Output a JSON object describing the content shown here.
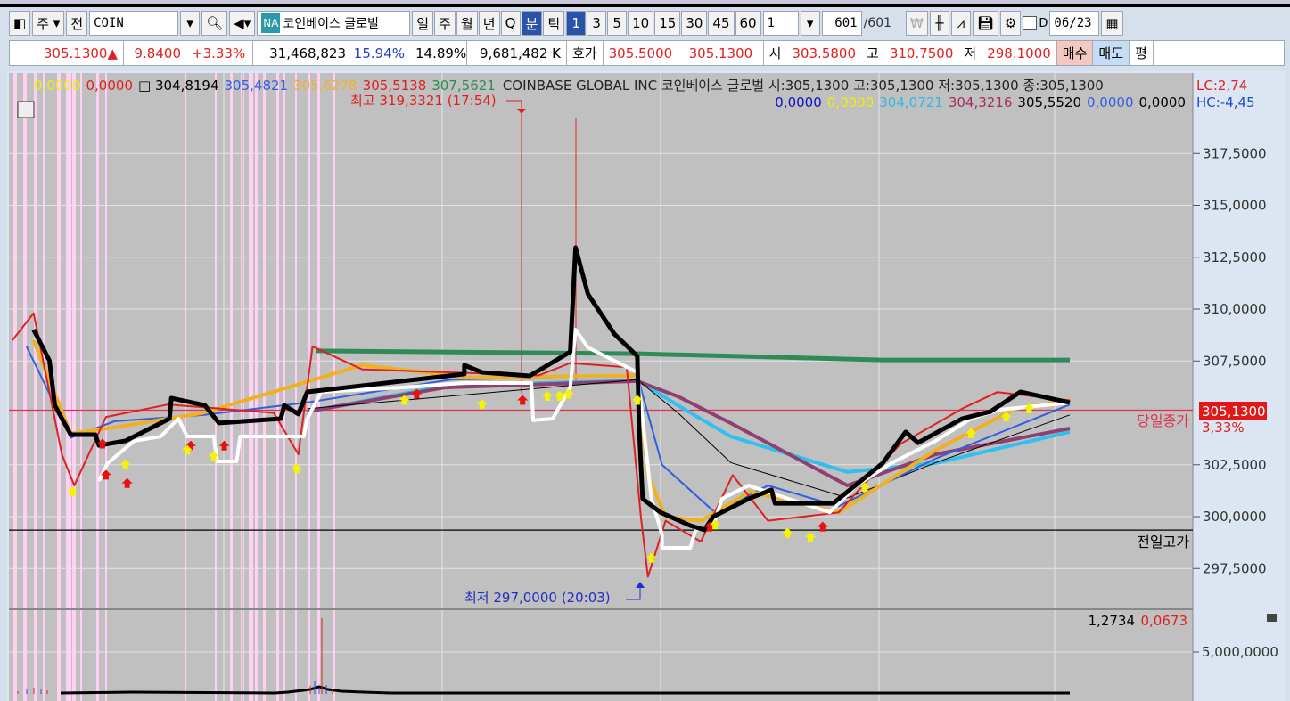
{
  "toolbar": {
    "market": "주",
    "full": "전",
    "symbol": "COIN",
    "name_badge": "NA",
    "name": "코인베이스 글로벌",
    "periods": [
      "일",
      "주",
      "월",
      "년",
      "Q",
      "분",
      "틱"
    ],
    "selected_period": "분",
    "intervals": [
      "1",
      "3",
      "5",
      "10",
      "15",
      "30",
      "45",
      "60"
    ],
    "selected_interval": "1",
    "interval_input": "1",
    "count": "601",
    "count_total": "/601",
    "d_label": "D",
    "date": "06/23"
  },
  "quote": {
    "price": "305.1300▲",
    "change": "9.8400",
    "change_pct": "+3.33%",
    "volume": "31,468,823",
    "pct1": "15.94%",
    "pct2": "14.89%",
    "amount": "9,681,482 K",
    "hoga_label": "호가",
    "hoga1": "305.5000",
    "hoga2": "305.1300",
    "open_label": "시",
    "open": "303.5800",
    "high_label": "고",
    "high": "310.7500",
    "low_label": "저",
    "low": "298.1000",
    "buy": "매수",
    "sell": "매도",
    "avg": "평"
  },
  "legend": {
    "row1": [
      {
        "t": "0,0000",
        "c": "#f0f000"
      },
      {
        "t": "0,0000",
        "c": "#e02020"
      },
      {
        "t": "□ 304,8194",
        "c": "#000000"
      },
      {
        "t": "305,4821",
        "c": "#3060e0"
      },
      {
        "t": "305,6278",
        "c": "#f0b030"
      },
      {
        "t": "305,5138",
        "c": "#e02020"
      },
      {
        "t": "307,5621",
        "c": "#2e8b57"
      }
    ],
    "title": "COINBASE GLOBAL INC  코인베이스 글로벌 시:305,1300 고:305,1300 저:305,1300 종:305,1300",
    "row2": [
      {
        "t": "0,0000",
        "c": "#1010c0"
      },
      {
        "t": "0,0000",
        "c": "#f0f000"
      },
      {
        "t": "304,0721",
        "c": "#30b8e8"
      },
      {
        "t": "304,3216",
        "c": "#a03060"
      },
      {
        "t": "305,5520",
        "c": "#000000"
      },
      {
        "t": "0,0000",
        "c": "#3060e0"
      },
      {
        "t": "0,0000",
        "c": "#000000"
      }
    ],
    "lc": "LC:2,74",
    "hc": "HC:-4,45"
  },
  "annotations": {
    "high": "최고 319,3321 (17:54)",
    "low": "최저 297,0000 (20:03)",
    "today_close": "당일종가",
    "prev_high": "전일고가",
    "current_price": "305,1300",
    "current_pct": "3,33%",
    "vol_vals": [
      "1,2734",
      "0,0673"
    ]
  },
  "chart_data": {
    "type": "line",
    "yticks": [
      "317,5000",
      "315,0000",
      "312,5000",
      "310,0000",
      "307,5000",
      "302,5000",
      "300,0000",
      "297,5000"
    ],
    "ytick_values": [
      317.5,
      315,
      312.5,
      310,
      307.5,
      302.5,
      300,
      297.5
    ],
    "ylim": [
      296.2,
      320.5
    ],
    "xlim": [
      0,
      601
    ],
    "reference_lines": [
      {
        "label": "당일종가",
        "value": 305.13,
        "color": "#e03050"
      },
      {
        "label": "전일고가",
        "value": 299.35,
        "color": "#000000"
      }
    ],
    "volume_ticks": [
      "5,000,0000"
    ],
    "series": [
      {
        "color": "#2e8b57",
        "width": 5,
        "points": [
          [
            174,
            307.99
          ],
          [
            356,
            307.85
          ],
          [
            495,
            307.55
          ],
          [
            601,
            307.55
          ]
        ]
      },
      {
        "color": "#30c0f0",
        "width": 4,
        "points": [
          [
            169,
            305.06
          ],
          [
            247,
            306.3
          ],
          [
            356,
            306.57
          ],
          [
            379,
            305.36
          ],
          [
            409,
            303.86
          ],
          [
            475,
            302.15
          ],
          [
            525,
            302.58
          ],
          [
            601,
            304.08
          ]
        ]
      },
      {
        "color": "#904070",
        "width": 4,
        "points": [
          [
            169,
            305.06
          ],
          [
            247,
            306.22
          ],
          [
            356,
            306.53
          ],
          [
            379,
            305.79
          ],
          [
            409,
            304.5
          ],
          [
            475,
            301.5
          ],
          [
            525,
            303
          ],
          [
            601,
            304.25
          ]
        ]
      },
      {
        "color": "#000000",
        "width": 1,
        "points": [
          [
            169,
            305.2
          ],
          [
            356,
            306.6
          ],
          [
            379,
            305.0
          ],
          [
            409,
            302.6
          ],
          [
            475,
            300.9
          ],
          [
            525,
            302.6
          ],
          [
            601,
            304.9
          ]
        ]
      },
      {
        "color": "#3060e0",
        "width": 2,
        "points": [
          [
            10,
            308.2
          ],
          [
            35,
            303.8
          ],
          [
            60,
            304.6
          ],
          [
            110,
            304.9
          ],
          [
            169,
            305.5
          ],
          [
            250,
            306.6
          ],
          [
            356,
            306.8
          ],
          [
            370,
            302.5
          ],
          [
            400,
            300.2
          ],
          [
            430,
            301.5
          ],
          [
            470,
            300.5
          ],
          [
            525,
            302.8
          ],
          [
            601,
            305.4
          ]
        ]
      },
      {
        "color": "#f0b020",
        "width": 4,
        "points": [
          [
            14,
            308.5
          ],
          [
            35,
            304.0
          ],
          [
            60,
            304.3
          ],
          [
            110,
            305.0
          ],
          [
            169,
            306.5
          ],
          [
            200,
            307.3
          ],
          [
            260,
            306.7
          ],
          [
            356,
            306.8
          ],
          [
            362,
            302
          ],
          [
            372,
            300
          ],
          [
            392,
            299.8
          ],
          [
            420,
            301.2
          ],
          [
            470,
            300.2
          ],
          [
            525,
            303.2
          ],
          [
            570,
            305.2
          ],
          [
            601,
            305.6
          ]
        ]
      },
      {
        "color": "#e02020",
        "width": 2,
        "points": [
          [
            2,
            308.5
          ],
          [
            14,
            309.8
          ],
          [
            30,
            303.0
          ],
          [
            37,
            301.5
          ],
          [
            55,
            304.8
          ],
          [
            90,
            305.4
          ],
          [
            150,
            305.0
          ],
          [
            164,
            303.0
          ],
          [
            172,
            308.2
          ],
          [
            200,
            307.1
          ],
          [
            300,
            306.8
          ],
          [
            318,
            307.4
          ],
          [
            350,
            307.2
          ],
          [
            358,
            300
          ],
          [
            362,
            297.1
          ],
          [
            372,
            299.8
          ],
          [
            392,
            298.8
          ],
          [
            410,
            302
          ],
          [
            430,
            299.8
          ],
          [
            470,
            300.2
          ],
          [
            505,
            303.5
          ],
          [
            540,
            305.2
          ],
          [
            560,
            306.0
          ],
          [
            601,
            305.6
          ]
        ]
      },
      {
        "color": "#ffffff",
        "width": 4,
        "points": [
          [
            51,
            301.72
          ],
          [
            56,
            302.58
          ],
          [
            71,
            303.65
          ],
          [
            86,
            303.86
          ],
          [
            96,
            304.72
          ],
          [
            101,
            303.86
          ],
          [
            116,
            303.86
          ],
          [
            118,
            302.66
          ],
          [
            129,
            302.66
          ],
          [
            131,
            303.86
          ],
          [
            167,
            303.86
          ],
          [
            169,
            304.72
          ],
          [
            177,
            306.01
          ],
          [
            222,
            306.22
          ],
          [
            258,
            306.44
          ],
          [
            296,
            306.44
          ],
          [
            297,
            304.64
          ],
          [
            308,
            304.72
          ],
          [
            318,
            306.22
          ],
          [
            321,
            309.01
          ],
          [
            328,
            308.15
          ],
          [
            356,
            306.95
          ],
          [
            364,
            300.86
          ],
          [
            370,
            299.14
          ],
          [
            370,
            298.5
          ],
          [
            386,
            298.5
          ],
          [
            389,
            299.36
          ],
          [
            399,
            299.57
          ],
          [
            404,
            300.86
          ],
          [
            419,
            301.5
          ],
          [
            434,
            301.07
          ],
          [
            465,
            300.21
          ],
          [
            480,
            301.5
          ],
          [
            500,
            302.58
          ],
          [
            525,
            303.65
          ],
          [
            545,
            304.72
          ],
          [
            561,
            305.15
          ],
          [
            601,
            305.49
          ]
        ]
      },
      {
        "color": "#000000",
        "width": 5,
        "points": [
          [
            14,
            309.01
          ],
          [
            23,
            307.51
          ],
          [
            26,
            305.36
          ],
          [
            35,
            303.95
          ],
          [
            49,
            303.95
          ],
          [
            51,
            303.43
          ],
          [
            66,
            303.65
          ],
          [
            91,
            304.72
          ],
          [
            92,
            305.71
          ],
          [
            111,
            305.36
          ],
          [
            119,
            304.51
          ],
          [
            154,
            304.72
          ],
          [
            156,
            305.36
          ],
          [
            164,
            304.94
          ],
          [
            169,
            306.01
          ],
          [
            258,
            306.87
          ],
          [
            258,
            307.3
          ],
          [
            268,
            306.95
          ],
          [
            295,
            306.78
          ],
          [
            318,
            307.94
          ],
          [
            321,
            312.96
          ],
          [
            328,
            310.73
          ],
          [
            343,
            308.8
          ],
          [
            356,
            307.73
          ],
          [
            357,
            304.29
          ],
          [
            359,
            300.86
          ],
          [
            369,
            300.21
          ],
          [
            386,
            299.57
          ],
          [
            394,
            299.36
          ],
          [
            399,
            300
          ],
          [
            419,
            300.86
          ],
          [
            432,
            301.29
          ],
          [
            434,
            300.64
          ],
          [
            467,
            300.64
          ],
          [
            495,
            302.58
          ],
          [
            508,
            304.08
          ],
          [
            515,
            303.56
          ],
          [
            540,
            304.72
          ],
          [
            556,
            305.06
          ],
          [
            573,
            306.01
          ],
          [
            601,
            305.49
          ]
        ]
      }
    ],
    "buy_markers": [
      [
        55,
        302.0
      ],
      [
        67,
        301.6
      ],
      [
        53,
        303.5
      ],
      [
        103,
        303.4
      ],
      [
        122,
        303.4
      ],
      [
        231,
        305.9
      ],
      [
        291,
        305.6
      ],
      [
        397,
        299.5
      ],
      [
        461,
        299.5
      ]
    ],
    "yellow_markers": [
      [
        36,
        301.2
      ],
      [
        66,
        302.5
      ],
      [
        101,
        303.2
      ],
      [
        116,
        302.9
      ],
      [
        163,
        302.3
      ],
      [
        224,
        305.6
      ],
      [
        268,
        305.4
      ],
      [
        305,
        305.8
      ],
      [
        312,
        305.8
      ],
      [
        317,
        305.9
      ],
      [
        356,
        305.6
      ],
      [
        364,
        298.0
      ],
      [
        400,
        299.6
      ],
      [
        441,
        299.2
      ],
      [
        454,
        299.0
      ],
      [
        485,
        301.4
      ],
      [
        545,
        304.0
      ],
      [
        565,
        304.8
      ],
      [
        578,
        305.2
      ]
    ]
  },
  "colors": {
    "chart_bg": "#c0c0c0",
    "axis_bg": "#dce6f2",
    "highlight_band": "#ffd0f4",
    "price_tag": "#e01818"
  }
}
